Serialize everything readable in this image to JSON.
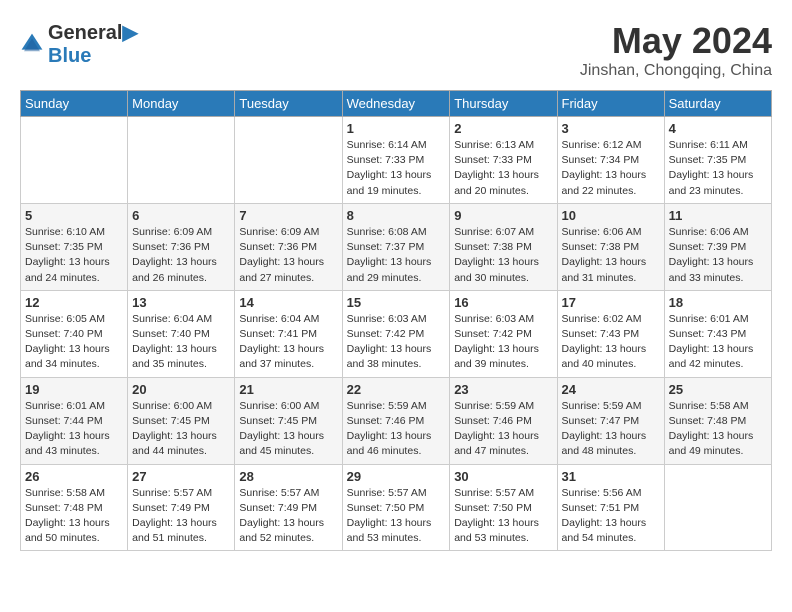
{
  "header": {
    "logo_line1": "General",
    "logo_line2": "Blue",
    "month": "May 2024",
    "location": "Jinshan, Chongqing, China"
  },
  "days_of_week": [
    "Sunday",
    "Monday",
    "Tuesday",
    "Wednesday",
    "Thursday",
    "Friday",
    "Saturday"
  ],
  "weeks": [
    [
      {
        "day": "",
        "info": ""
      },
      {
        "day": "",
        "info": ""
      },
      {
        "day": "",
        "info": ""
      },
      {
        "day": "1",
        "info": "Sunrise: 6:14 AM\nSunset: 7:33 PM\nDaylight: 13 hours\nand 19 minutes."
      },
      {
        "day": "2",
        "info": "Sunrise: 6:13 AM\nSunset: 7:33 PM\nDaylight: 13 hours\nand 20 minutes."
      },
      {
        "day": "3",
        "info": "Sunrise: 6:12 AM\nSunset: 7:34 PM\nDaylight: 13 hours\nand 22 minutes."
      },
      {
        "day": "4",
        "info": "Sunrise: 6:11 AM\nSunset: 7:35 PM\nDaylight: 13 hours\nand 23 minutes."
      }
    ],
    [
      {
        "day": "5",
        "info": "Sunrise: 6:10 AM\nSunset: 7:35 PM\nDaylight: 13 hours\nand 24 minutes."
      },
      {
        "day": "6",
        "info": "Sunrise: 6:09 AM\nSunset: 7:36 PM\nDaylight: 13 hours\nand 26 minutes."
      },
      {
        "day": "7",
        "info": "Sunrise: 6:09 AM\nSunset: 7:36 PM\nDaylight: 13 hours\nand 27 minutes."
      },
      {
        "day": "8",
        "info": "Sunrise: 6:08 AM\nSunset: 7:37 PM\nDaylight: 13 hours\nand 29 minutes."
      },
      {
        "day": "9",
        "info": "Sunrise: 6:07 AM\nSunset: 7:38 PM\nDaylight: 13 hours\nand 30 minutes."
      },
      {
        "day": "10",
        "info": "Sunrise: 6:06 AM\nSunset: 7:38 PM\nDaylight: 13 hours\nand 31 minutes."
      },
      {
        "day": "11",
        "info": "Sunrise: 6:06 AM\nSunset: 7:39 PM\nDaylight: 13 hours\nand 33 minutes."
      }
    ],
    [
      {
        "day": "12",
        "info": "Sunrise: 6:05 AM\nSunset: 7:40 PM\nDaylight: 13 hours\nand 34 minutes."
      },
      {
        "day": "13",
        "info": "Sunrise: 6:04 AM\nSunset: 7:40 PM\nDaylight: 13 hours\nand 35 minutes."
      },
      {
        "day": "14",
        "info": "Sunrise: 6:04 AM\nSunset: 7:41 PM\nDaylight: 13 hours\nand 37 minutes."
      },
      {
        "day": "15",
        "info": "Sunrise: 6:03 AM\nSunset: 7:42 PM\nDaylight: 13 hours\nand 38 minutes."
      },
      {
        "day": "16",
        "info": "Sunrise: 6:03 AM\nSunset: 7:42 PM\nDaylight: 13 hours\nand 39 minutes."
      },
      {
        "day": "17",
        "info": "Sunrise: 6:02 AM\nSunset: 7:43 PM\nDaylight: 13 hours\nand 40 minutes."
      },
      {
        "day": "18",
        "info": "Sunrise: 6:01 AM\nSunset: 7:43 PM\nDaylight: 13 hours\nand 42 minutes."
      }
    ],
    [
      {
        "day": "19",
        "info": "Sunrise: 6:01 AM\nSunset: 7:44 PM\nDaylight: 13 hours\nand 43 minutes."
      },
      {
        "day": "20",
        "info": "Sunrise: 6:00 AM\nSunset: 7:45 PM\nDaylight: 13 hours\nand 44 minutes."
      },
      {
        "day": "21",
        "info": "Sunrise: 6:00 AM\nSunset: 7:45 PM\nDaylight: 13 hours\nand 45 minutes."
      },
      {
        "day": "22",
        "info": "Sunrise: 5:59 AM\nSunset: 7:46 PM\nDaylight: 13 hours\nand 46 minutes."
      },
      {
        "day": "23",
        "info": "Sunrise: 5:59 AM\nSunset: 7:46 PM\nDaylight: 13 hours\nand 47 minutes."
      },
      {
        "day": "24",
        "info": "Sunrise: 5:59 AM\nSunset: 7:47 PM\nDaylight: 13 hours\nand 48 minutes."
      },
      {
        "day": "25",
        "info": "Sunrise: 5:58 AM\nSunset: 7:48 PM\nDaylight: 13 hours\nand 49 minutes."
      }
    ],
    [
      {
        "day": "26",
        "info": "Sunrise: 5:58 AM\nSunset: 7:48 PM\nDaylight: 13 hours\nand 50 minutes."
      },
      {
        "day": "27",
        "info": "Sunrise: 5:57 AM\nSunset: 7:49 PM\nDaylight: 13 hours\nand 51 minutes."
      },
      {
        "day": "28",
        "info": "Sunrise: 5:57 AM\nSunset: 7:49 PM\nDaylight: 13 hours\nand 52 minutes."
      },
      {
        "day": "29",
        "info": "Sunrise: 5:57 AM\nSunset: 7:50 PM\nDaylight: 13 hours\nand 53 minutes."
      },
      {
        "day": "30",
        "info": "Sunrise: 5:57 AM\nSunset: 7:50 PM\nDaylight: 13 hours\nand 53 minutes."
      },
      {
        "day": "31",
        "info": "Sunrise: 5:56 AM\nSunset: 7:51 PM\nDaylight: 13 hours\nand 54 minutes."
      },
      {
        "day": "",
        "info": ""
      }
    ]
  ]
}
